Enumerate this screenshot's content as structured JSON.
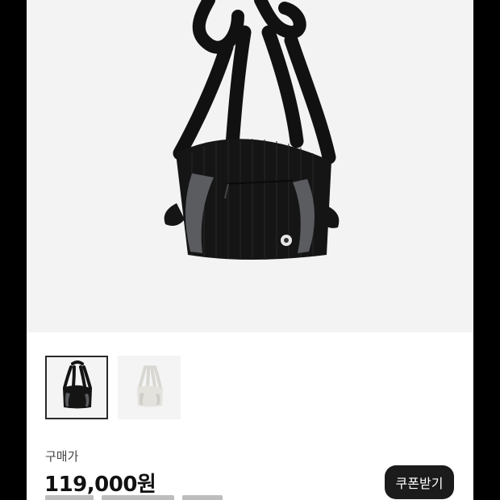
{
  "product": {
    "images": [
      {
        "name": "black-bag",
        "color": "#141414",
        "accent": "#5a5c60"
      },
      {
        "name": "white-bag",
        "color": "#e9e7e2",
        "accent": "#cfcdc8"
      }
    ],
    "selected_image": 0,
    "price_label": "구매가",
    "price": "119,000원",
    "coupon_button": "쿠폰받기"
  },
  "colors": {
    "background": "#000000",
    "page": "#ffffff",
    "hero_bg": "#f3f3f3",
    "button": "#1b1b1b"
  }
}
